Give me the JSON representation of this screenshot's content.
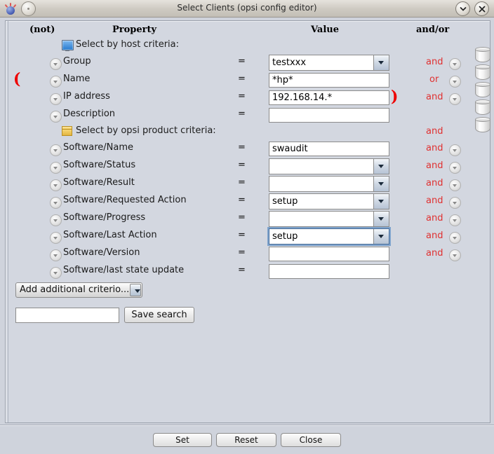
{
  "window": {
    "title": "Select Clients (opsi config editor)",
    "app_icon": "opsi-orb-icon",
    "menu_button": "window-menu-icon",
    "minimize_button": "chevron-down-icon",
    "close_button": "close-icon"
  },
  "headers": {
    "not": "(not)",
    "property": "Property",
    "value": "Value",
    "andor": "and/or"
  },
  "sections": [
    {
      "icon": "monitor-icon",
      "label": "Select by host criteria:",
      "andor": ""
    },
    {
      "icon": "package-icon",
      "label": "Select by opsi product criteria:",
      "andor": "and"
    }
  ],
  "rows": [
    {
      "property": "Group",
      "operator": "=",
      "value": "testxxx",
      "widget": "combo",
      "focused": false,
      "andor": "and",
      "andor_chevron": true,
      "paren": ""
    },
    {
      "property": "Name",
      "operator": "=",
      "value": "*hp*",
      "widget": "text",
      "focused": false,
      "andor": "or",
      "andor_chevron": true,
      "paren": "("
    },
    {
      "property": "IP address",
      "operator": "=",
      "value": "192.168.14.*",
      "widget": "text",
      "focused": false,
      "andor": "and",
      "andor_chevron": true,
      "paren": ")"
    },
    {
      "property": "Description",
      "operator": "=",
      "value": "",
      "widget": "text",
      "focused": false,
      "andor": "",
      "andor_chevron": false,
      "paren": ""
    },
    {
      "property": "Software/Name",
      "operator": "=",
      "value": "swaudit",
      "widget": "text",
      "focused": false,
      "andor": "and",
      "andor_chevron": true,
      "paren": ""
    },
    {
      "property": "Software/Status",
      "operator": "=",
      "value": "",
      "widget": "combo",
      "focused": false,
      "andor": "and",
      "andor_chevron": true,
      "paren": ""
    },
    {
      "property": "Software/Result",
      "operator": "=",
      "value": "",
      "widget": "combo",
      "focused": false,
      "andor": "and",
      "andor_chevron": true,
      "paren": ""
    },
    {
      "property": "Software/Requested Action",
      "operator": "=",
      "value": "setup",
      "widget": "combo",
      "focused": false,
      "andor": "and",
      "andor_chevron": true,
      "paren": ""
    },
    {
      "property": "Software/Progress",
      "operator": "=",
      "value": "",
      "widget": "combo",
      "focused": false,
      "andor": "and",
      "andor_chevron": true,
      "paren": ""
    },
    {
      "property": "Software/Last Action",
      "operator": "=",
      "value": "setup",
      "widget": "combo",
      "focused": true,
      "andor": "and",
      "andor_chevron": true,
      "paren": ""
    },
    {
      "property": "Software/Version",
      "operator": "=",
      "value": "",
      "widget": "text",
      "focused": false,
      "andor": "and",
      "andor_chevron": true,
      "paren": ""
    },
    {
      "property": "Software/last state update",
      "operator": "=",
      "value": "",
      "widget": "text",
      "focused": false,
      "andor": "",
      "andor_chevron": false,
      "paren": ""
    }
  ],
  "cylinder_icons": [
    "group-cylinder-icon",
    "name-cylinder-icon",
    "ip-cylinder-icon",
    "description-cylinder-icon",
    "product-cylinder-icon"
  ],
  "add_criteria": {
    "label": "Add additional criterio...",
    "chevron": "chevron-down-icon"
  },
  "save_search": {
    "input_value": "",
    "placeholder": "",
    "button_label": "Save search"
  },
  "footer": {
    "set_label": "Set",
    "reset_label": "Reset",
    "close_label": "Close"
  },
  "colors": {
    "accent_red": "#e03030",
    "paren_red": "#ee0000",
    "panel_bg": "#d3d7e0",
    "title_bg": "#cdc9c1"
  }
}
